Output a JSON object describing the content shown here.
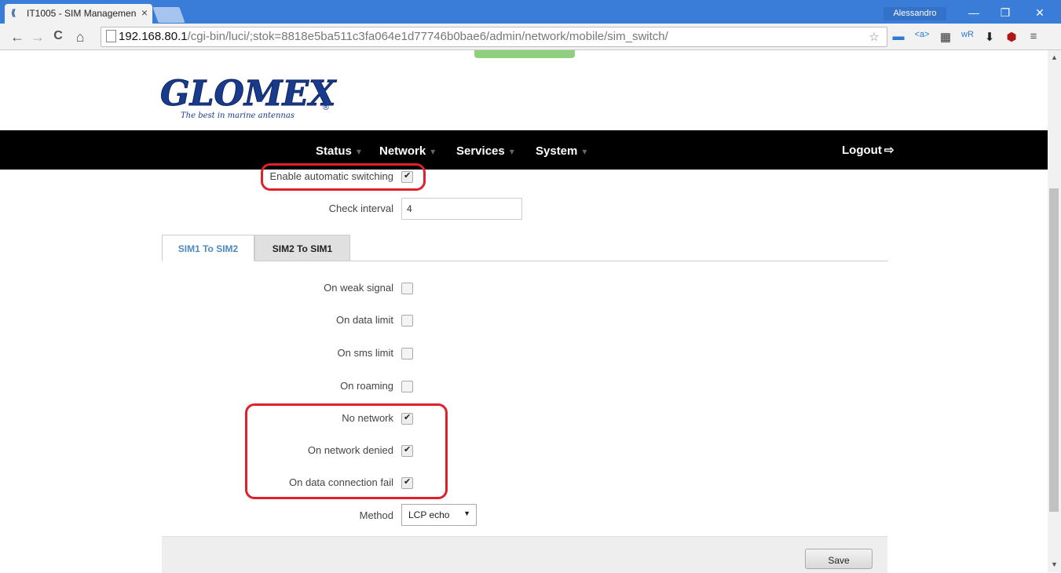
{
  "browser": {
    "tab_title": "IT1005 - SIM Managemen",
    "tab_close": "×",
    "user": "Alessandro",
    "url_host": "192.168.80.1",
    "url_path": "/cgi-bin/luci/;stok=8818e5ba511c3fa064e1d77746b0bae6/admin/network/mobile/sim_switch/"
  },
  "logo": {
    "brand": "GLOMEX",
    "tagline": "The best in marine antennas",
    "registered": "®"
  },
  "menu": {
    "items": [
      "Status",
      "Network",
      "Services",
      "System"
    ],
    "logout": "Logout"
  },
  "form": {
    "auto_switch_label": "Enable automatic switching",
    "auto_switch_checked": true,
    "check_interval_label": "Check interval",
    "check_interval_value": "4",
    "tabs": [
      "SIM1 To SIM2",
      "SIM2 To SIM1"
    ],
    "options": [
      {
        "label": "On weak signal",
        "checked": false
      },
      {
        "label": "On data limit",
        "checked": false
      },
      {
        "label": "On sms limit",
        "checked": false
      },
      {
        "label": "On roaming",
        "checked": false
      },
      {
        "label": "No network",
        "checked": true
      },
      {
        "label": "On network denied",
        "checked": true
      },
      {
        "label": "On data connection fail",
        "checked": true
      }
    ],
    "method_label": "Method",
    "method_value": "LCP echo",
    "save_label": "Save"
  },
  "colors": {
    "highlight": "#e0202b",
    "tab_active_text": "#4c8bc2",
    "menubar": "#000000"
  }
}
